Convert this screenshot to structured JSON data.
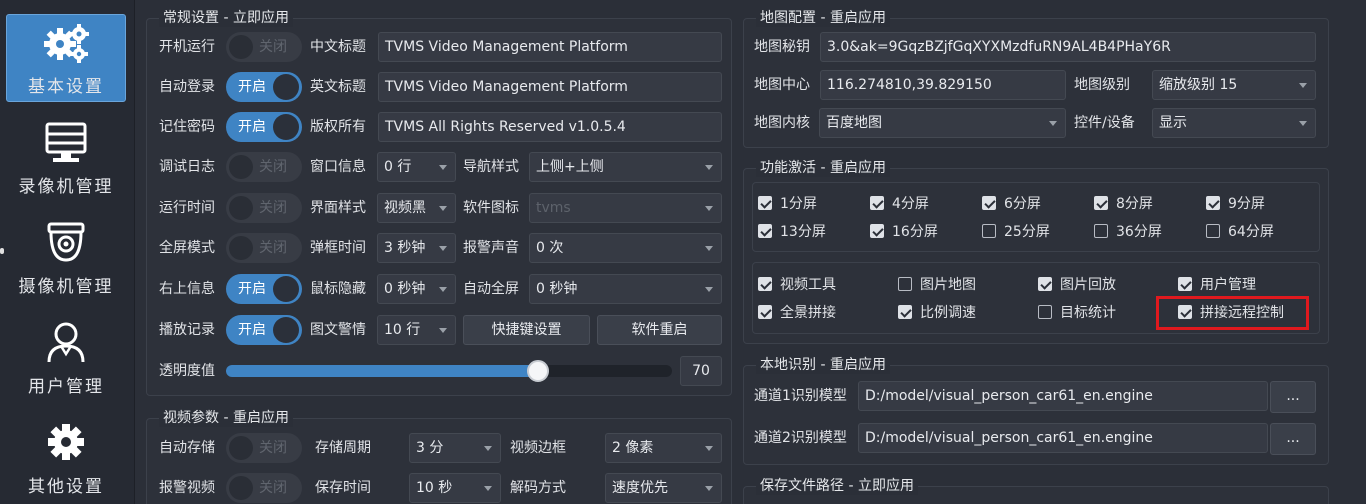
{
  "nav": {
    "items": [
      {
        "label": "基本设置",
        "icon": "gears-icon",
        "active": true
      },
      {
        "label": "录像机管理",
        "icon": "nvr-icon"
      },
      {
        "label": "摄像机管理",
        "icon": "camera-icon"
      },
      {
        "label": "用户管理",
        "icon": "user-icon"
      },
      {
        "label": "其他设置",
        "icon": "gear-icon"
      }
    ]
  },
  "general": {
    "title": "常规设置 - 立即应用",
    "boot_run": {
      "label": "开机运行",
      "state": "关闭"
    },
    "auto_login": {
      "label": "自动登录",
      "state": "开启"
    },
    "remember_pwd": {
      "label": "记住密码",
      "state": "开启"
    },
    "debug_log": {
      "label": "调试日志",
      "state": "关闭"
    },
    "run_time": {
      "label": "运行时间",
      "state": "关闭"
    },
    "full_screen": {
      "label": "全屏模式",
      "state": "关闭"
    },
    "top_right_info": {
      "label": "右上信息",
      "state": "开启"
    },
    "play_record": {
      "label": "播放记录",
      "state": "开启"
    },
    "cn_title": {
      "label": "中文标题",
      "value": "TVMS Video Management Platform"
    },
    "en_title": {
      "label": "英文标题",
      "value": "TVMS Video Management Platform"
    },
    "copyright": {
      "label": "版权所有",
      "value": "TVMS All Rights Reserved  v1.0.5.4"
    },
    "window_info": {
      "label": "窗口信息",
      "value": "0 行"
    },
    "nav_style": {
      "label": "导航样式",
      "value": "上侧+上侧"
    },
    "ui_style": {
      "label": "界面样式",
      "value": "视频黑"
    },
    "app_icon": {
      "label": "软件图标",
      "value": "tvms"
    },
    "popup_time": {
      "label": "弹框时间",
      "value": "3 秒钟"
    },
    "alarm_sound": {
      "label": "报警声音",
      "value": "0 次"
    },
    "mouse_hide": {
      "label": "鼠标隐藏",
      "value": "0 秒钟"
    },
    "auto_fullscreen": {
      "label": "自动全屏",
      "value": "0 秒钟"
    },
    "image_alarm": {
      "label": "图文警情",
      "value": "10 行"
    },
    "shortcut_btn": "快捷键设置",
    "restart_btn": "软件重启",
    "opacity": {
      "label": "透明度值",
      "value": "70",
      "percent": 70
    }
  },
  "video": {
    "title": "视频参数 - 重启应用",
    "auto_save": {
      "label": "自动存储",
      "state": "关闭"
    },
    "alarm_video": {
      "label": "报警视频",
      "state": "关闭"
    },
    "save_period": {
      "label": "存储周期",
      "value": "3 分"
    },
    "keep_time": {
      "label": "保存时间",
      "value": "10 秒"
    },
    "video_border": {
      "label": "视频边框",
      "value": "2 像素"
    },
    "decode_mode": {
      "label": "解码方式",
      "value": "速度优先"
    }
  },
  "map": {
    "title": "地图配置 - 重启应用",
    "key": {
      "label": "地图秘钥",
      "value": "3.0&ak=9GqzBZjfGqXYXMzdfuRN9AL4B4PHaY6R"
    },
    "center": {
      "label": "地图中心",
      "value": "116.274810,39.829150"
    },
    "level": {
      "label": "地图级别",
      "value": "缩放级别 15"
    },
    "core": {
      "label": "地图内核",
      "value": "百度地图"
    },
    "control": {
      "label": "控件/设备",
      "value": "显示"
    }
  },
  "features": {
    "title": "功能激活 - 重启应用",
    "screens": [
      {
        "label": "1分屏",
        "checked": true
      },
      {
        "label": "4分屏",
        "checked": true
      },
      {
        "label": "6分屏",
        "checked": true
      },
      {
        "label": "8分屏",
        "checked": true
      },
      {
        "label": "9分屏",
        "checked": true
      },
      {
        "label": "13分屏",
        "checked": true
      },
      {
        "label": "16分屏",
        "checked": true
      },
      {
        "label": "25分屏",
        "checked": false
      },
      {
        "label": "36分屏",
        "checked": false
      },
      {
        "label": "64分屏",
        "checked": false
      }
    ],
    "tools": [
      {
        "label": "视频工具",
        "checked": true
      },
      {
        "label": "图片地图",
        "checked": false
      },
      {
        "label": "图片回放",
        "checked": true
      },
      {
        "label": "用户管理",
        "checked": true
      },
      {
        "label": "全景拼接",
        "checked": true
      },
      {
        "label": "比例调速",
        "checked": true
      },
      {
        "label": "目标统计",
        "checked": false
      },
      {
        "label": "拼接远程控制",
        "checked": true
      }
    ]
  },
  "recognition": {
    "title": "本地识别 - 重启应用",
    "ch1": {
      "label": "通道1识别模型",
      "value": "D:/model/visual_person_car61_en.engine"
    },
    "ch2": {
      "label": "通道2识别模型",
      "value": "D:/model/visual_person_car61_en.engine"
    },
    "browse": "..."
  },
  "save_path": {
    "title": "保存文件路径 - 立即应用"
  },
  "colors": {
    "accent": "#3f84c4",
    "highlight": "#e0191e",
    "background": "#2b2f38"
  }
}
